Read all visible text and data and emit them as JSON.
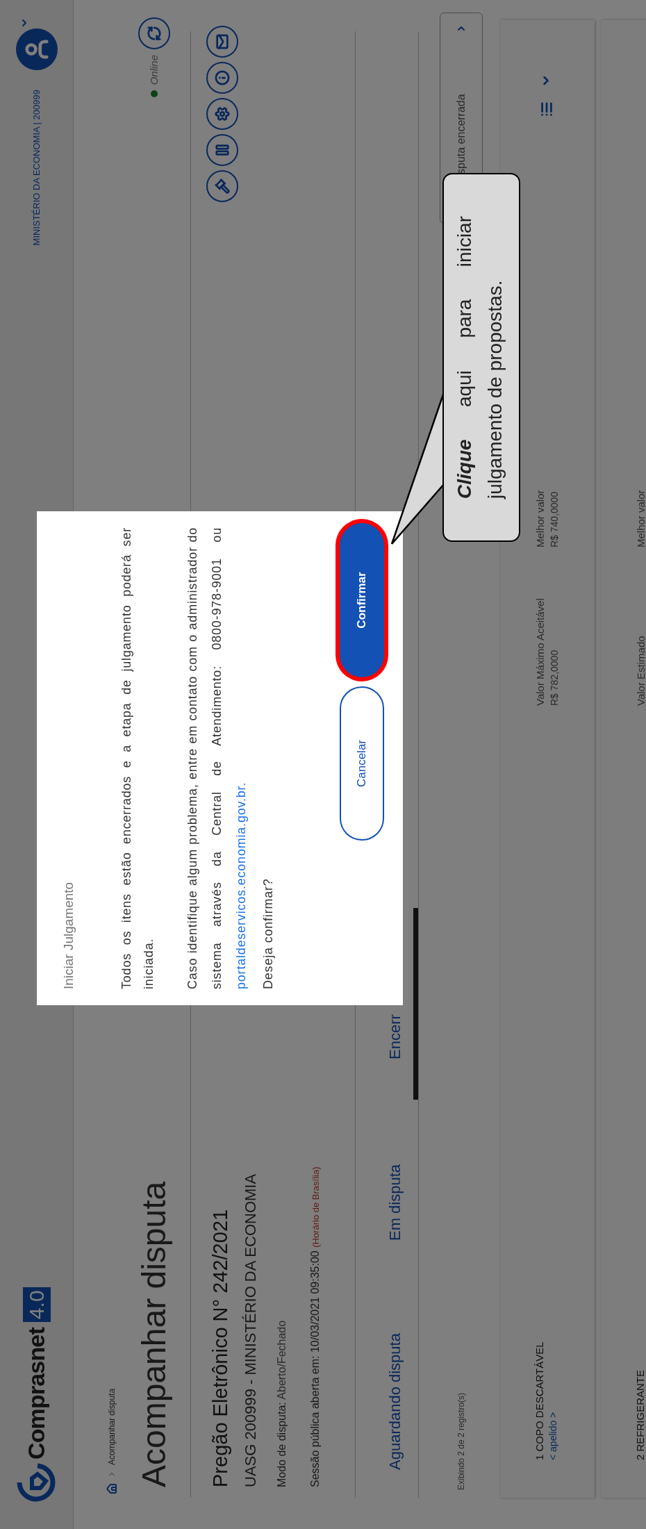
{
  "header": {
    "logo_text": "Comprasnet",
    "logo_badge": "4.0",
    "organization": "MINISTÉRIO DA ECONOMIA | 200999"
  },
  "breadcrumb": {
    "items": [
      "Acompanhar disputa"
    ]
  },
  "page_title": "Acompanhar disputa",
  "status": {
    "label": "Online"
  },
  "pregao": {
    "title": "Pregão Eletrônico N° 242/2021",
    "uasg": "UASG 200999 - MINISTÉRIO DA ECONOMIA",
    "modo_label": "Modo de disputa:",
    "modo_value": "Aberto/Fechado",
    "sessao_label": "Sessão pública aberta em:",
    "sessao_value": "10/03/2021 09:35:00",
    "sessao_note": "(Horário de Brasília)"
  },
  "tabs": [
    {
      "label": "Aguardando disputa",
      "selected": false
    },
    {
      "label": "Em disputa",
      "selected": false
    },
    {
      "label": "Encerr",
      "selected": true
    }
  ],
  "records": {
    "summary": "Exibindo 2 de 2 registro(s)",
    "filter_value": "sputa encerrada"
  },
  "items": [
    {
      "title": "1  COPO DESCARTÁVEL",
      "nickname": "< apelido >",
      "value_label": "Valor Máximo Aceitável",
      "value": "R$ 782,0000",
      "best_label": "Melhor valor",
      "best_value": "R$ 740,0000"
    },
    {
      "title": "2  REFRIGERANTE",
      "value_label": "Valor Estimado",
      "best_label": "Melhor valor"
    }
  ],
  "dialog": {
    "title": "Iniciar Julgamento",
    "paragraph_1": "Todos os itens estão encerrados e a etapa de julgamento poderá ser iniciada.",
    "paragraph_2": "Caso identifique algum problema, entre em contato com o administrador do sistema através da Central de Atendimento: 0800-978-9001 ou",
    "link": "portaldeservicos.economia.gov.br.",
    "question": "Deseja confirmar?",
    "cancel": "Cancelar",
    "confirm": "Confirmar",
    "confirm_highlighted": true
  },
  "callout": {
    "text": "**Clique** aqui para iniciar julgamento de propostas."
  }
}
